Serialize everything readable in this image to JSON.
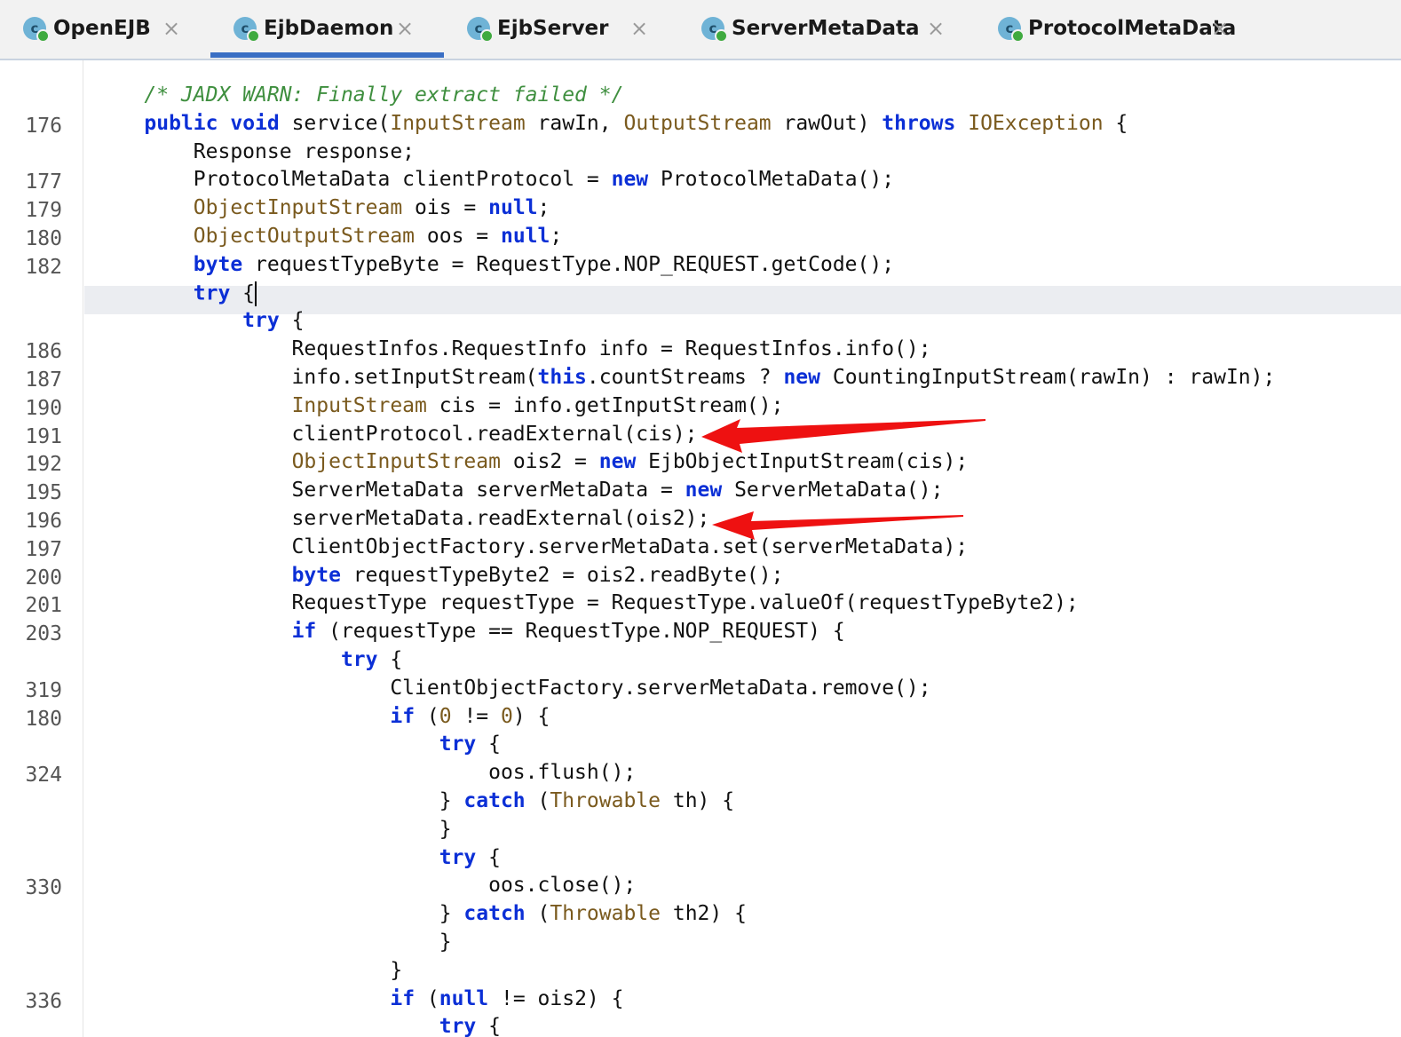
{
  "tabs": [
    {
      "label": "OpenEJB",
      "icon": "class-icon",
      "active": false
    },
    {
      "label": "EjbDaemon",
      "icon": "class-icon",
      "active": true
    },
    {
      "label": "EjbServer",
      "icon": "class-icon",
      "active": false
    },
    {
      "label": "ServerMetaData",
      "icon": "class-icon",
      "active": false
    },
    {
      "label": "ProtocolMetaData",
      "icon": "class-icon",
      "active": false
    }
  ],
  "icon_letter": "c",
  "close_glyph": "×",
  "line_numbers": [
    "",
    "176",
    "",
    "177",
    "179",
    "180",
    "182",
    "",
    "",
    "186",
    "187",
    "190",
    "191",
    "192",
    "195",
    "196",
    "197",
    "200",
    "201",
    "203",
    "",
    "319",
    "180",
    "",
    "324",
    "",
    "",
    "",
    "330",
    "",
    "",
    "",
    "336",
    ""
  ],
  "code_lines": [
    [
      {
        "t": "    "
      },
      {
        "t": "/* JADX WARN: Finally extract failed */",
        "c": "cm"
      }
    ],
    [
      {
        "t": "    "
      },
      {
        "t": "public",
        "c": "kw"
      },
      {
        "t": " "
      },
      {
        "t": "void",
        "c": "kw"
      },
      {
        "t": " service("
      },
      {
        "t": "InputStream",
        "c": "ty"
      },
      {
        "t": " rawIn, "
      },
      {
        "t": "OutputStream",
        "c": "ty"
      },
      {
        "t": " rawOut) "
      },
      {
        "t": "throws",
        "c": "kw"
      },
      {
        "t": " "
      },
      {
        "t": "IOException",
        "c": "ty"
      },
      {
        "t": " {"
      }
    ],
    [
      {
        "t": "        Response response;"
      }
    ],
    [
      {
        "t": "        ProtocolMetaData clientProtocol = "
      },
      {
        "t": "new",
        "c": "kw"
      },
      {
        "t": " ProtocolMetaData();"
      }
    ],
    [
      {
        "t": "        "
      },
      {
        "t": "ObjectInputStream",
        "c": "ty"
      },
      {
        "t": " ois = "
      },
      {
        "t": "null",
        "c": "kw"
      },
      {
        "t": ";"
      }
    ],
    [
      {
        "t": "        "
      },
      {
        "t": "ObjectOutputStream",
        "c": "ty"
      },
      {
        "t": " oos = "
      },
      {
        "t": "null",
        "c": "kw"
      },
      {
        "t": ";"
      }
    ],
    [
      {
        "t": "        "
      },
      {
        "t": "byte",
        "c": "kw"
      },
      {
        "t": " requestTypeByte = RequestType.NOP_REQUEST.getCode();"
      }
    ],
    [
      {
        "t": "        "
      },
      {
        "t": "try",
        "c": "kw"
      },
      {
        "t": " {"
      },
      {
        "caret": true
      }
    ],
    [
      {
        "t": "            "
      },
      {
        "t": "try",
        "c": "kw"
      },
      {
        "t": " {"
      }
    ],
    [
      {
        "t": "                RequestInfos.RequestInfo info = RequestInfos.info();"
      }
    ],
    [
      {
        "t": "                info.setInputStream("
      },
      {
        "t": "this",
        "c": "kw"
      },
      {
        "t": ".countStreams ? "
      },
      {
        "t": "new",
        "c": "kw"
      },
      {
        "t": " CountingInputStream(rawIn) : rawIn);"
      }
    ],
    [
      {
        "t": "                "
      },
      {
        "t": "InputStream",
        "c": "ty"
      },
      {
        "t": " cis = info.getInputStream();"
      }
    ],
    [
      {
        "t": "                clientProtocol.readExternal(cis);"
      }
    ],
    [
      {
        "t": "                "
      },
      {
        "t": "ObjectInputStream",
        "c": "ty"
      },
      {
        "t": " ois2 = "
      },
      {
        "t": "new",
        "c": "kw"
      },
      {
        "t": " EjbObjectInputStream(cis);"
      }
    ],
    [
      {
        "t": "                ServerMetaData serverMetaData = "
      },
      {
        "t": "new",
        "c": "kw"
      },
      {
        "t": " ServerMetaData();"
      }
    ],
    [
      {
        "t": "                serverMetaData.readExternal(ois2);"
      }
    ],
    [
      {
        "t": "                ClientObjectFactory.serverMetaData.set(serverMetaData);"
      }
    ],
    [
      {
        "t": "                "
      },
      {
        "t": "byte",
        "c": "kw"
      },
      {
        "t": " requestTypeByte2 = ois2.readByte();"
      }
    ],
    [
      {
        "t": "                RequestType requestType = RequestType.valueOf(requestTypeByte2);"
      }
    ],
    [
      {
        "t": "                "
      },
      {
        "t": "if",
        "c": "kw"
      },
      {
        "t": " (requestType == RequestType.NOP_REQUEST) {"
      }
    ],
    [
      {
        "t": "                    "
      },
      {
        "t": "try",
        "c": "kw"
      },
      {
        "t": " {"
      }
    ],
    [
      {
        "t": "                        ClientObjectFactory.serverMetaData.remove();"
      }
    ],
    [
      {
        "t": "                        "
      },
      {
        "t": "if",
        "c": "kw"
      },
      {
        "t": " ("
      },
      {
        "t": "0",
        "c": "ty"
      },
      {
        "t": " != "
      },
      {
        "t": "0",
        "c": "ty"
      },
      {
        "t": ") {"
      }
    ],
    [
      {
        "t": "                            "
      },
      {
        "t": "try",
        "c": "kw"
      },
      {
        "t": " {"
      }
    ],
    [
      {
        "t": "                                oos.flush();"
      }
    ],
    [
      {
        "t": "                            } "
      },
      {
        "t": "catch",
        "c": "kw"
      },
      {
        "t": " ("
      },
      {
        "t": "Throwable",
        "c": "ty"
      },
      {
        "t": " th) {"
      }
    ],
    [
      {
        "t": "                            }"
      }
    ],
    [
      {
        "t": "                            "
      },
      {
        "t": "try",
        "c": "kw"
      },
      {
        "t": " {"
      }
    ],
    [
      {
        "t": "                                oos.close();"
      }
    ],
    [
      {
        "t": "                            } "
      },
      {
        "t": "catch",
        "c": "kw"
      },
      {
        "t": " ("
      },
      {
        "t": "Throwable",
        "c": "ty"
      },
      {
        "t": " th2) {"
      }
    ],
    [
      {
        "t": "                            }"
      }
    ],
    [
      {
        "t": "                        }"
      }
    ],
    [
      {
        "t": "                        "
      },
      {
        "t": "if",
        "c": "kw"
      },
      {
        "t": " ("
      },
      {
        "t": "null",
        "c": "kw"
      },
      {
        "t": " != ois2) {"
      }
    ],
    [
      {
        "t": "                            "
      },
      {
        "t": "try",
        "c": "kw"
      },
      {
        "t": " {"
      }
    ]
  ],
  "colors": {
    "keyword": "#0b2fd6",
    "type": "#7a5a1e",
    "comment": "#3f8f3f",
    "annotation_arrow": "#ee1111",
    "active_tab_underline": "#3a6fc4"
  }
}
